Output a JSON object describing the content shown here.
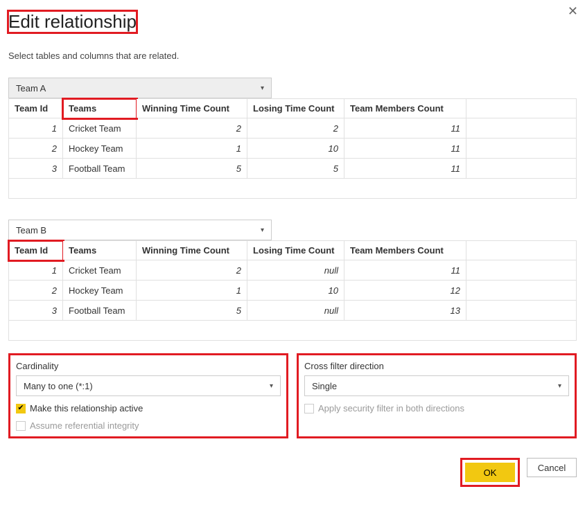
{
  "dialog": {
    "title": "Edit relationship",
    "subtitle": "Select tables and columns that are related."
  },
  "tableA": {
    "selected": "Team A",
    "columns": [
      "Team Id",
      "Teams",
      "Winning Time Count",
      "Losing Time Count",
      "Team Members Count"
    ],
    "rows": [
      {
        "id": "1",
        "teams": "Cricket Team",
        "win": "2",
        "lose": "2",
        "mem": "11"
      },
      {
        "id": "2",
        "teams": "Hockey Team",
        "win": "1",
        "lose": "10",
        "mem": "11"
      },
      {
        "id": "3",
        "teams": "Football Team",
        "win": "5",
        "lose": "5",
        "mem": "11"
      }
    ]
  },
  "tableB": {
    "selected": "Team B",
    "columns": [
      "Team Id",
      "Teams",
      "Winning Time Count",
      "Losing Time Count",
      "Team Members Count"
    ],
    "rows": [
      {
        "id": "1",
        "teams": "Cricket Team",
        "win": "2",
        "lose": "null",
        "mem": "11"
      },
      {
        "id": "2",
        "teams": "Hockey Team",
        "win": "1",
        "lose": "10",
        "mem": "12"
      },
      {
        "id": "3",
        "teams": "Football Team",
        "win": "5",
        "lose": "null",
        "mem": "13"
      }
    ]
  },
  "cardinality": {
    "label": "Cardinality",
    "value": "Many to one (*:1)",
    "active_label": "Make this relationship active",
    "integrity_label": "Assume referential integrity"
  },
  "crossfilter": {
    "label": "Cross filter direction",
    "value": "Single",
    "security_label": "Apply security filter in both directions"
  },
  "buttons": {
    "ok": "OK",
    "cancel": "Cancel"
  }
}
